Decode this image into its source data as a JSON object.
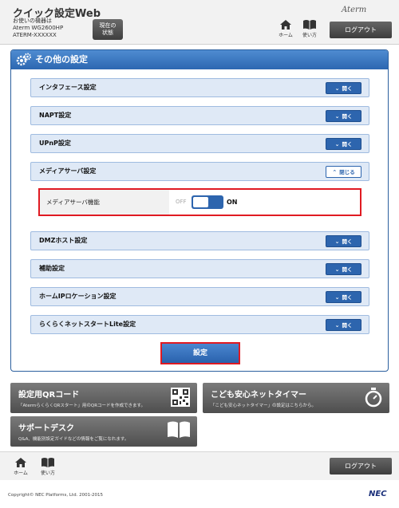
{
  "header": {
    "app_title": "クイック設定Web",
    "device_line1": "お使いの機器は",
    "device_line2": "Aterm WG2600HP",
    "device_line3": "ATERM-XXXXXX",
    "status_button_line1": "現在の",
    "status_button_line2": "状態",
    "brand": "Aterm",
    "home_label": "ホーム",
    "help_label": "使い方",
    "logout_label": "ログアウト"
  },
  "panel": {
    "title": "その他の設定",
    "sections": [
      {
        "label": "インタフェース設定",
        "button": "開く",
        "state": "closed"
      },
      {
        "label": "NAPT設定",
        "button": "開く",
        "state": "closed"
      },
      {
        "label": "UPnP設定",
        "button": "開く",
        "state": "closed"
      },
      {
        "label": "メディアサーバ設定",
        "button": "閉じる",
        "state": "open"
      },
      {
        "label": "DMZホスト設定",
        "button": "開く",
        "state": "closed"
      },
      {
        "label": "補助設定",
        "button": "開く",
        "state": "closed"
      },
      {
        "label": "ホームIPロケーション設定",
        "button": "開く",
        "state": "closed"
      },
      {
        "label": "らくらくネットスタートLite設定",
        "button": "開く",
        "state": "closed"
      }
    ],
    "media_server": {
      "label": "メディアサーバ機能",
      "off_label": "OFF",
      "on_label": "ON",
      "value": "ON"
    },
    "submit_label": "設定"
  },
  "tiles": {
    "qr": {
      "title": "設定用QRコード",
      "desc": "「AtermらくらくQRスタート」用のQRコードを作成できます。"
    },
    "timer": {
      "title": "こども安心ネットタイマー",
      "desc": "「こども安心ネットタイマー」の設定はこちらから。"
    },
    "support": {
      "title": "サポートデスク",
      "desc": "Q&A、機能別設定ガイドなどの情報をご覧になれます。"
    }
  },
  "footer": {
    "home_label": "ホーム",
    "help_label": "使い方",
    "logout_label": "ログアウト",
    "copyright": "Copyright© NEC Platforms, Ltd. 2001-2015",
    "logo": "NEC"
  },
  "colors": {
    "accent_blue": "#2d65ae",
    "section_bg": "#dfe9f6",
    "highlight_red": "#e01a22",
    "tile_gray": "#5e5e5e"
  },
  "icons": [
    "home-icon",
    "book-icon",
    "gear-icon",
    "qr-code-icon",
    "stopwatch-icon",
    "open-book-icon"
  ]
}
